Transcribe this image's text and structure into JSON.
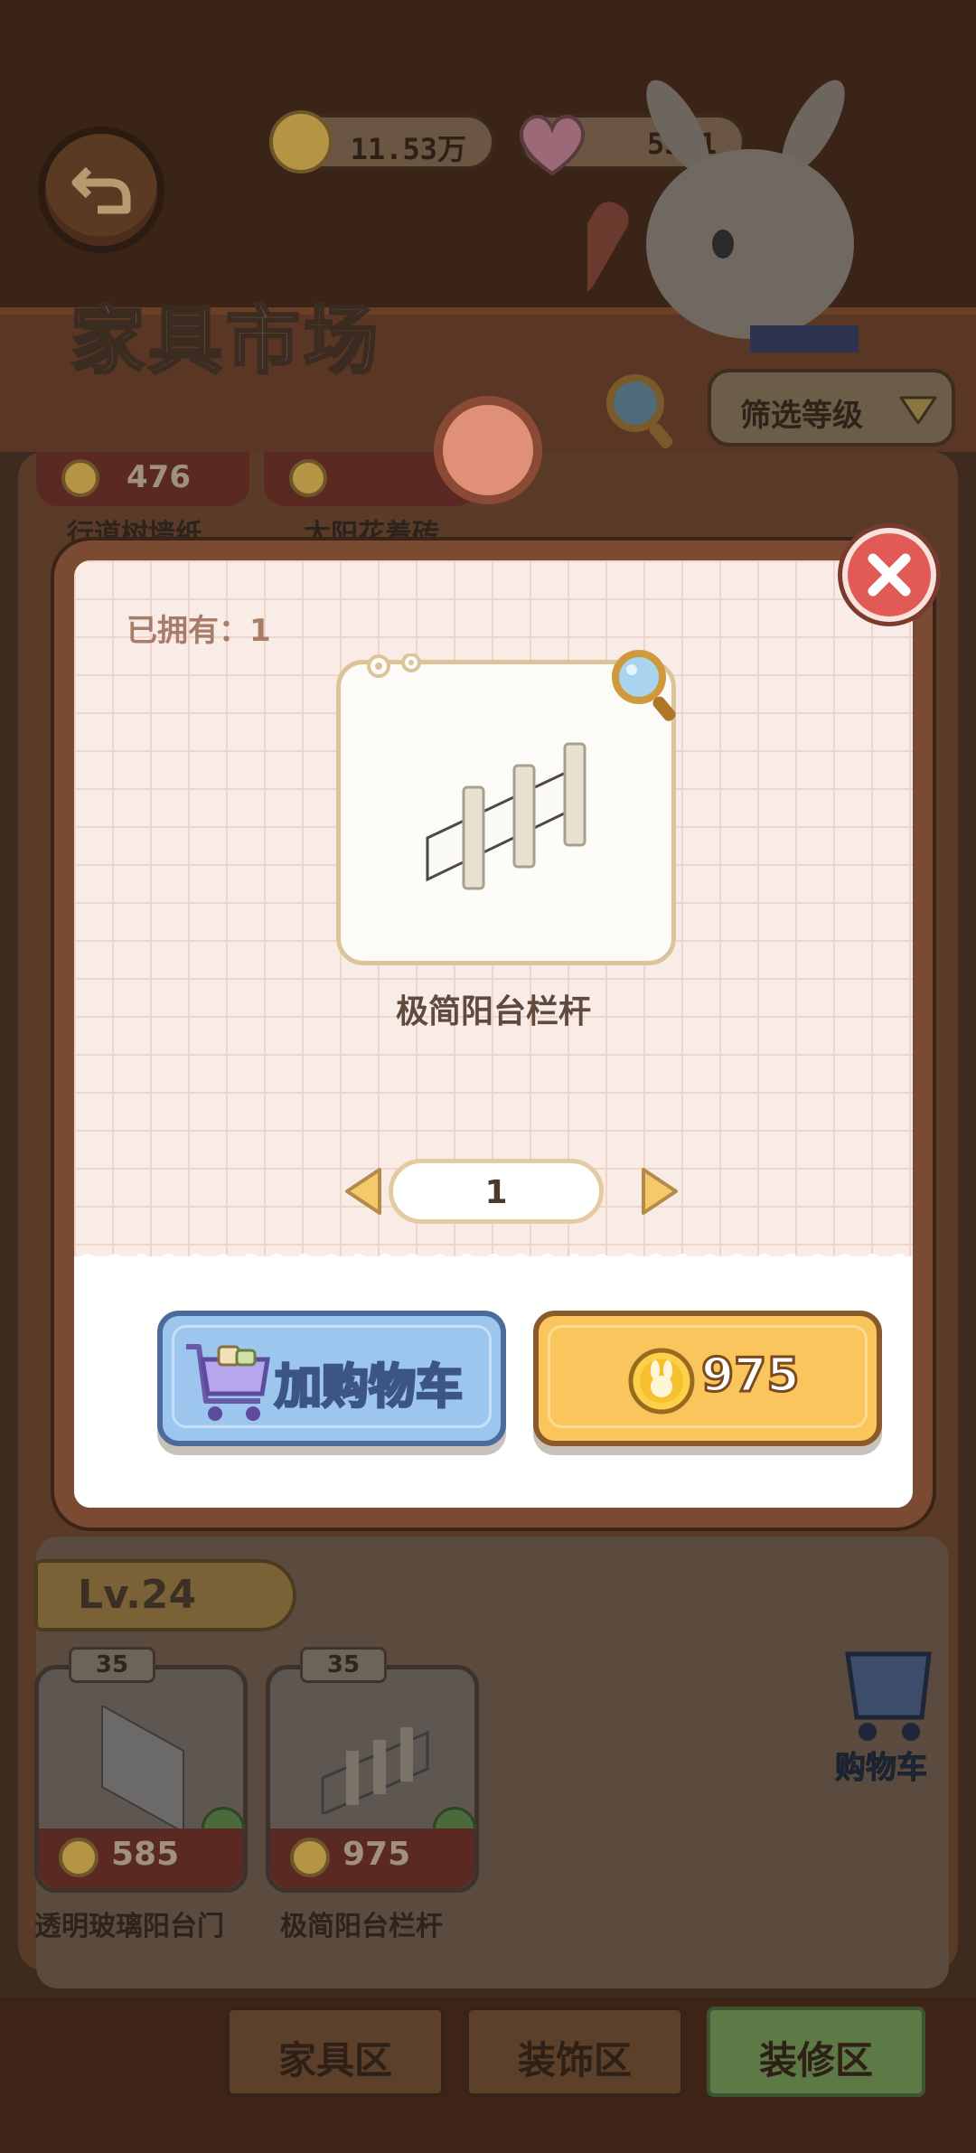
{
  "header": {
    "title": "家具市场",
    "coins": "11.53万",
    "hearts": "5341",
    "filter_label": "筛选等级"
  },
  "background_list": {
    "top_row": {
      "items": [
        {
          "price": "476",
          "name": "行道树墙纸"
        },
        {
          "price": "",
          "name": "太阳花着砖"
        }
      ]
    },
    "level_label": "Lv.24",
    "items": [
      {
        "level": "35",
        "price": "585",
        "name": "透明玻璃阳台门",
        "owned": true
      },
      {
        "level": "35",
        "price": "975",
        "name": "极简阳台栏杆",
        "owned": true
      }
    ],
    "cart_label": "购物车"
  },
  "tabs": [
    {
      "label": "家具区"
    },
    {
      "label": "装饰区"
    },
    {
      "label": "装修区"
    }
  ],
  "modal": {
    "owned_text": "已拥有：1",
    "item_name": "极简阳台栏杆",
    "quantity": "1",
    "add_to_cart_label": "加购物车",
    "price": "975"
  },
  "colors": {
    "accent_gold": "#f9c55c",
    "accent_blue": "#9cc6ee",
    "close_red": "#e25a55",
    "modal_frame": "#7a4a32"
  }
}
